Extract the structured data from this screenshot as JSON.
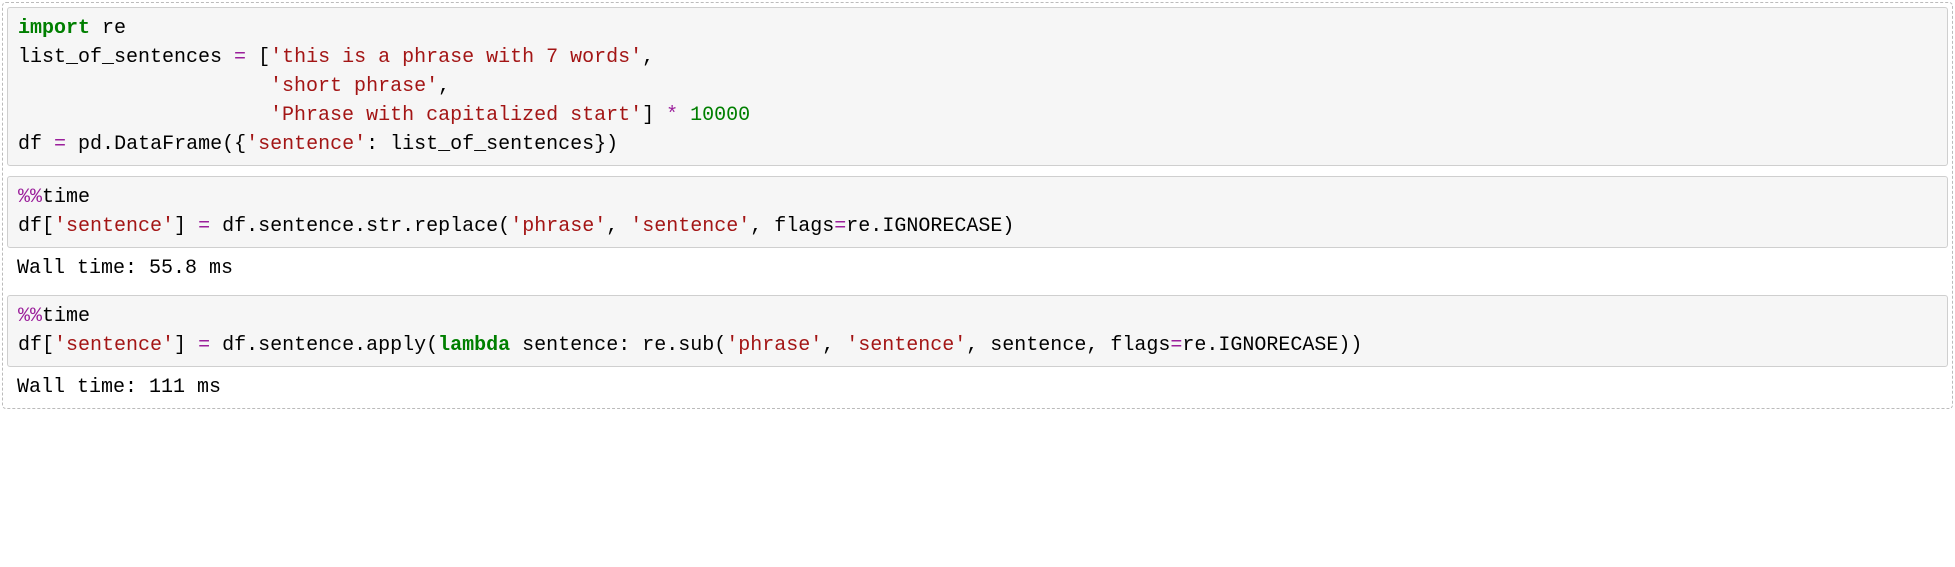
{
  "cells": [
    {
      "type": "code",
      "tokens": [
        {
          "t": "import",
          "c": "kw"
        },
        {
          "t": " re\n"
        },
        {
          "t": "list_of_sentences "
        },
        {
          "t": "=",
          "c": "op"
        },
        {
          "t": " ["
        },
        {
          "t": "'this is a phrase with 7 words'",
          "c": "s1"
        },
        {
          "t": ",\n"
        },
        {
          "t": "                     "
        },
        {
          "t": "'short phrase'",
          "c": "s1"
        },
        {
          "t": ",\n"
        },
        {
          "t": "                     "
        },
        {
          "t": "'Phrase with capitalized start'",
          "c": "s1"
        },
        {
          "t": "] "
        },
        {
          "t": "*",
          "c": "op"
        },
        {
          "t": " "
        },
        {
          "t": "10000",
          "c": "nb"
        },
        {
          "t": "\n"
        },
        {
          "t": "df "
        },
        {
          "t": "=",
          "c": "op"
        },
        {
          "t": " pd"
        },
        {
          "t": "."
        },
        {
          "t": "DataFrame({"
        },
        {
          "t": "'sentence'",
          "c": "s1"
        },
        {
          "t": ": list_of_sentences})"
        }
      ],
      "output": null
    },
    {
      "type": "code",
      "tokens": [
        {
          "t": "%%",
          "c": "mg"
        },
        {
          "t": "time\n"
        },
        {
          "t": "df["
        },
        {
          "t": "'sentence'",
          "c": "s1"
        },
        {
          "t": "] "
        },
        {
          "t": "=",
          "c": "op"
        },
        {
          "t": " df"
        },
        {
          "t": "."
        },
        {
          "t": "sentence"
        },
        {
          "t": "."
        },
        {
          "t": "str"
        },
        {
          "t": "."
        },
        {
          "t": "replace("
        },
        {
          "t": "'phrase'",
          "c": "s1"
        },
        {
          "t": ", "
        },
        {
          "t": "'sentence'",
          "c": "s1"
        },
        {
          "t": ", flags"
        },
        {
          "t": "=",
          "c": "op"
        },
        {
          "t": "re"
        },
        {
          "t": "."
        },
        {
          "t": "IGNORECASE)"
        }
      ],
      "output": "Wall time: 55.8 ms"
    },
    {
      "type": "code",
      "tokens": [
        {
          "t": "%%",
          "c": "mg"
        },
        {
          "t": "time\n"
        },
        {
          "t": "df["
        },
        {
          "t": "'sentence'",
          "c": "s1"
        },
        {
          "t": "] "
        },
        {
          "t": "=",
          "c": "op"
        },
        {
          "t": " df"
        },
        {
          "t": "."
        },
        {
          "t": "sentence"
        },
        {
          "t": "."
        },
        {
          "t": "apply("
        },
        {
          "t": "lambda",
          "c": "kw"
        },
        {
          "t": " sentence: re"
        },
        {
          "t": "."
        },
        {
          "t": "sub("
        },
        {
          "t": "'phrase'",
          "c": "s1"
        },
        {
          "t": ", "
        },
        {
          "t": "'sentence'",
          "c": "s1"
        },
        {
          "t": ", sentence, flags"
        },
        {
          "t": "=",
          "c": "op"
        },
        {
          "t": "re"
        },
        {
          "t": "."
        },
        {
          "t": "IGNORECASE))"
        }
      ],
      "output": "Wall time: 111 ms"
    }
  ]
}
